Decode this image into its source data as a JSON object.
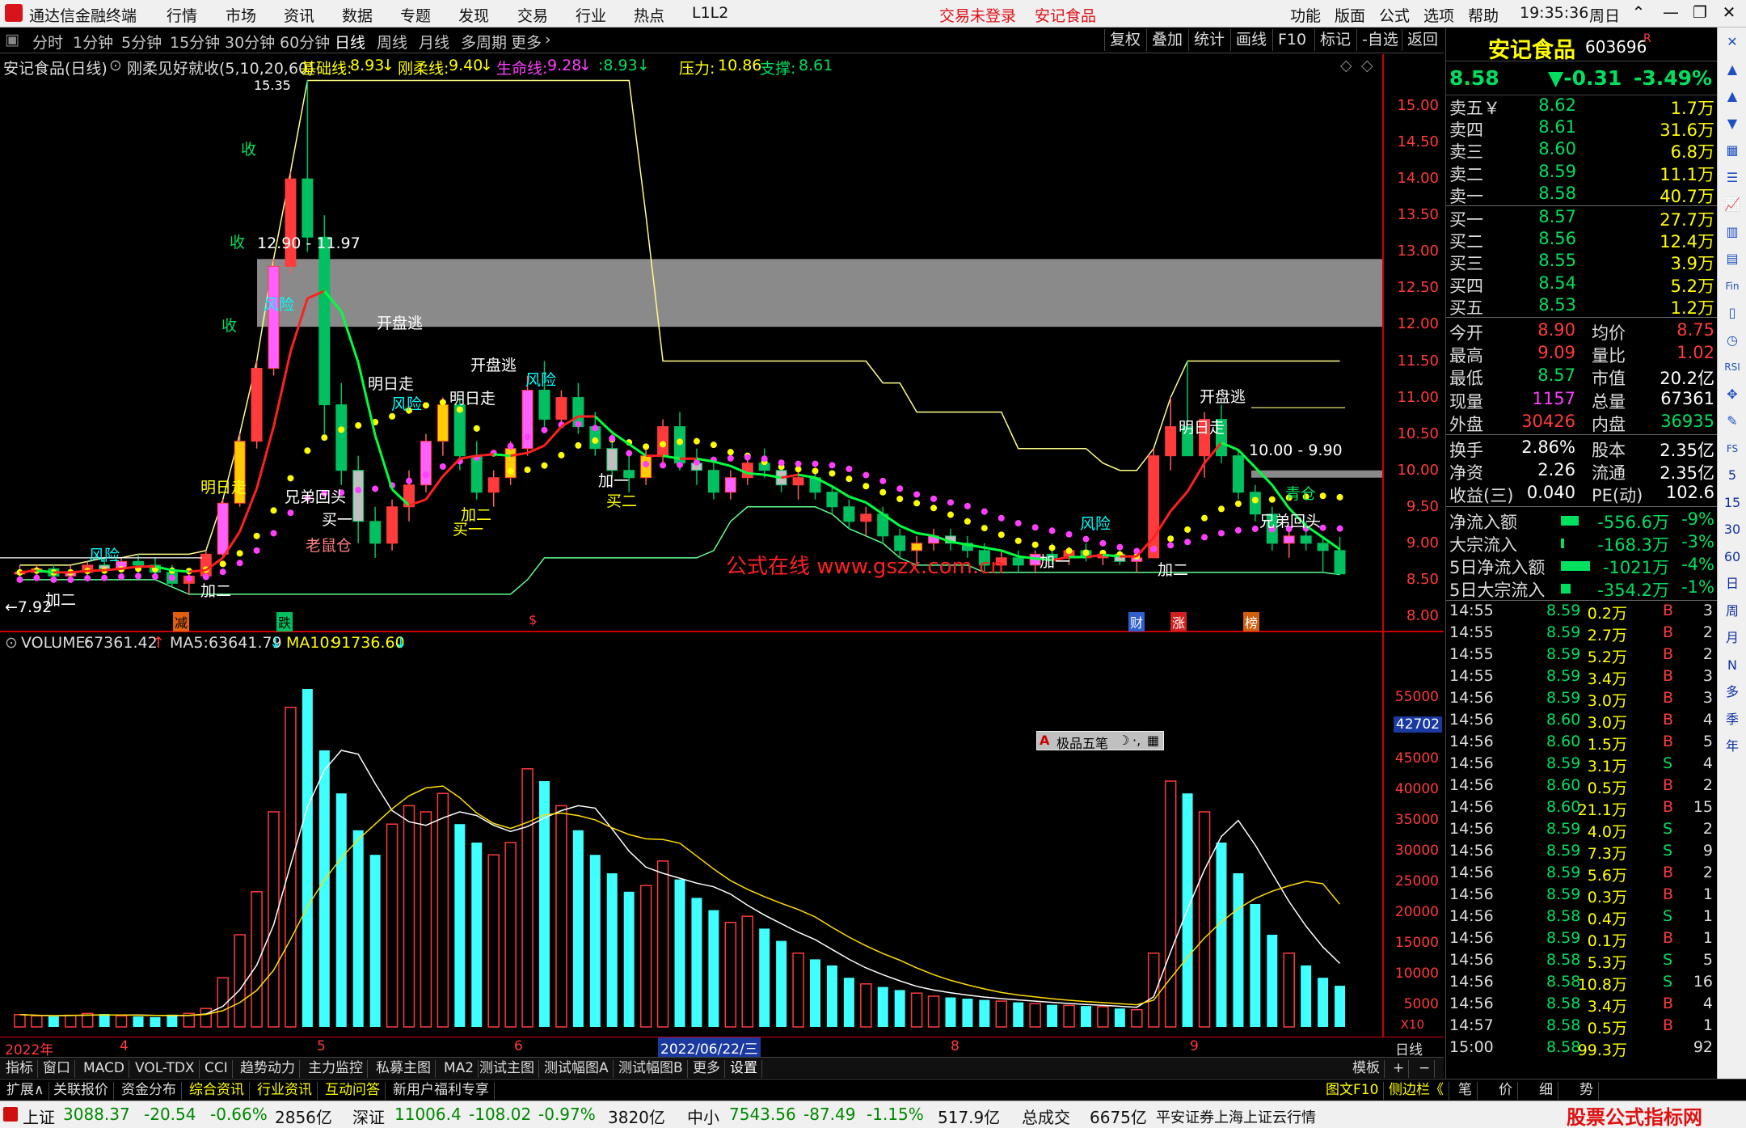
{
  "titlebar": {
    "app_title": "通达信金融终端",
    "menu": [
      "行情",
      "市场",
      "资讯",
      "数据",
      "专题",
      "发现",
      "交易",
      "行业",
      "热点",
      "L1L2"
    ],
    "notice_login": "交易未登录",
    "notice_stock": "安记食品",
    "right_menu": [
      "功能",
      "版面",
      "公式",
      "选项",
      "帮助"
    ],
    "clock": "19:35:36",
    "weekday": "周日"
  },
  "period_bar": {
    "periods": [
      "分时",
      "1分钟",
      "5分钟",
      "15分钟",
      "30分钟",
      "60分钟",
      "日线",
      "周线",
      "月线",
      "多周期",
      "更多"
    ],
    "active": "日线",
    "right_buttons": [
      "复权",
      "叠加",
      "统计",
      "画线",
      "F10",
      "标记",
      "-自选",
      "返回"
    ]
  },
  "indicator_header": {
    "stock": "安记食品(日线)",
    "formula": "刚柔见好就收(5,10,20,60)",
    "jichu_label": "基础线:",
    "jichu_val": "8.93",
    "gangrou_label": "刚柔线:",
    "gangrou_val": "9.40",
    "shengming_label": "生命线:",
    "shengming_val": "9.28",
    "extra_val": ":8.93",
    "yali_label": "压力:",
    "yali_val": "10.86",
    "zhicheng_label": "支撑:",
    "zhicheng_val": "8.61"
  },
  "price_axis": [
    "15.00",
    "14.50",
    "14.00",
    "13.50",
    "13.00",
    "12.50",
    "12.00",
    "11.50",
    "11.00",
    "10.50",
    "10.00",
    "9.50",
    "9.00",
    "8.50",
    "8.00"
  ],
  "volume_header": {
    "volume_label": "VOLUME:",
    "volume_val": "67361.42",
    "ma5_label": "MA5:",
    "ma5_val": "63641.79",
    "ma10_label": "MA10:",
    "ma10_val": "91736.60"
  },
  "volume_axis": [
    "55000",
    "50000",
    "45000",
    "40000",
    "35000",
    "30000",
    "25000",
    "20000",
    "15000",
    "10000",
    "5000"
  ],
  "volume_axis_current": "42702",
  "volume_axis_unit": "X10",
  "date_axis": {
    "labels": [
      "2022年",
      "4",
      "5",
      "6",
      "2022/06/22/三",
      "8",
      "9"
    ],
    "right": "日线"
  },
  "chart_annotations": {
    "range1": "12.90 - 11.97",
    "range2": "10.00 - 9.90",
    "low_label": "←7.92",
    "high_label": "15.35",
    "watermark": "公式在线 www.gszx.com.cn",
    "markers": [
      "减",
      "跌",
      "$",
      "财",
      "涨",
      "榜"
    ],
    "signals": [
      "开盘逃",
      "明日走",
      "风险",
      "收",
      "加二",
      "买一",
      "买二",
      "兄弟回头",
      "老鼠仓",
      "加一",
      "青仓"
    ]
  },
  "popup": {
    "label": "极品五笔"
  },
  "tabs1": [
    "指标",
    "窗口",
    "MACD",
    "VOL-TDX",
    "CCI",
    "趋势动力",
    "主力监控",
    "私募主图",
    "MA2",
    "测试主图",
    "测试幅图A",
    "测试幅图B",
    "更多",
    "设置",
    "模板"
  ],
  "tabs2": [
    "扩展∧",
    "关联报价",
    "资金分布",
    "综合资讯",
    "行业资讯",
    "互动问答",
    "新用户福利专享"
  ],
  "tabs2_right": [
    "图文F10",
    "侧边栏《",
    "笔",
    "价",
    "细",
    "势"
  ],
  "statusbar": {
    "sh_label": "上证",
    "sh_val": "3088.37",
    "sh_chg": "-20.54",
    "sh_pct": "-0.66%",
    "sh_amt": "2856亿",
    "sz_label": "深证",
    "sz_val": "11006.4",
    "sz_chg": "-108.02",
    "sz_pct": "-0.97%",
    "sz_amt": "3820亿",
    "zx_label": "中小",
    "zx_val": "7543.56",
    "zx_chg": "-87.49",
    "zx_pct": "-1.15%",
    "zx_amt": "517.9亿",
    "total_label": "总成交",
    "total_val": "6675亿",
    "server": "平安证券上海上证云行情"
  },
  "quote": {
    "name": "安记食品",
    "code": "603696",
    "flag": "R",
    "price": "8.58",
    "change": "▼-0.31",
    "pct": "-3.49%",
    "sells": [
      {
        "label": "卖五￥",
        "price": "8.62",
        "vol": "1.7万"
      },
      {
        "label": "卖四",
        "price": "8.61",
        "vol": "31.6万"
      },
      {
        "label": "卖三",
        "price": "8.60",
        "vol": "6.8万"
      },
      {
        "label": "卖二",
        "price": "8.59",
        "vol": "11.1万"
      },
      {
        "label": "卖一",
        "price": "8.58",
        "vol": "40.7万"
      }
    ],
    "buys": [
      {
        "label": "买一",
        "price": "8.57",
        "vol": "27.7万"
      },
      {
        "label": "买二",
        "price": "8.56",
        "vol": "12.4万"
      },
      {
        "label": "买三",
        "price": "8.55",
        "vol": "3.9万"
      },
      {
        "label": "买四",
        "price": "8.54",
        "vol": "5.2万"
      },
      {
        "label": "买五",
        "price": "8.53",
        "vol": "1.2万"
      }
    ],
    "stats": [
      {
        "l1": "今开",
        "v1": "8.90",
        "l2": "均价",
        "v2": "8.75"
      },
      {
        "l1": "最高",
        "v1": "9.09",
        "l2": "量比",
        "v2": "1.02"
      },
      {
        "l1": "最低",
        "v1": "8.57",
        "l2": "市值",
        "v2": "20.2亿"
      },
      {
        "l1": "现量",
        "v1": "1157",
        "l2": "总量",
        "v2": "67361"
      },
      {
        "l1": "外盘",
        "v1": "30426",
        "l2": "内盘",
        "v2": "36935"
      }
    ],
    "stats2": [
      {
        "l1": "换手",
        "v1": "2.86%",
        "l2": "股本",
        "v2": "2.35亿"
      },
      {
        "l1": "净资",
        "v1": "2.26",
        "l2": "流通",
        "v2": "2.35亿"
      },
      {
        "l1": "收益(三)",
        "v1": "0.040",
        "l2": "PE(动)",
        "v2": "102.6"
      }
    ],
    "flows": [
      {
        "label": "净流入额",
        "val": "-556.6万",
        "pct": "-9%"
      },
      {
        "label": "大宗流入",
        "val": "-168.3万",
        "pct": "-3%"
      },
      {
        "label": "5日净流入额",
        "val": "-1021万",
        "pct": "-4%"
      },
      {
        "label": "5日大宗流入",
        "val": "-354.2万",
        "pct": "-1%"
      }
    ],
    "ticks": [
      {
        "t": "14:55",
        "p": "8.59",
        "v": "0.2万",
        "d": "B",
        "n": "3"
      },
      {
        "t": "14:55",
        "p": "8.59",
        "v": "2.7万",
        "d": "B",
        "n": "2"
      },
      {
        "t": "14:55",
        "p": "8.59",
        "v": "5.2万",
        "d": "B",
        "n": "2"
      },
      {
        "t": "14:55",
        "p": "8.59",
        "v": "3.4万",
        "d": "B",
        "n": "3"
      },
      {
        "t": "14:56",
        "p": "8.59",
        "v": "3.0万",
        "d": "B",
        "n": "3"
      },
      {
        "t": "14:56",
        "p": "8.60",
        "v": "3.0万",
        "d": "B",
        "n": "4"
      },
      {
        "t": "14:56",
        "p": "8.60",
        "v": "1.5万",
        "d": "B",
        "n": "5"
      },
      {
        "t": "14:56",
        "p": "8.59",
        "v": "3.1万",
        "d": "S",
        "n": "4"
      },
      {
        "t": "14:56",
        "p": "8.60",
        "v": "0.5万",
        "d": "B",
        "n": "2"
      },
      {
        "t": "14:56",
        "p": "8.60",
        "v": "21.1万",
        "d": "B",
        "n": "15"
      },
      {
        "t": "14:56",
        "p": "8.59",
        "v": "4.0万",
        "d": "S",
        "n": "2"
      },
      {
        "t": "14:56",
        "p": "8.59",
        "v": "7.3万",
        "d": "S",
        "n": "9"
      },
      {
        "t": "14:56",
        "p": "8.59",
        "v": "5.6万",
        "d": "B",
        "n": "2"
      },
      {
        "t": "14:56",
        "p": "8.59",
        "v": "0.3万",
        "d": "B",
        "n": "1"
      },
      {
        "t": "14:56",
        "p": "8.58",
        "v": "0.4万",
        "d": "S",
        "n": "1"
      },
      {
        "t": "14:56",
        "p": "8.59",
        "v": "0.1万",
        "d": "B",
        "n": "1"
      },
      {
        "t": "14:56",
        "p": "8.58",
        "v": "5.3万",
        "d": "S",
        "n": "5"
      },
      {
        "t": "14:56",
        "p": "8.58",
        "v": "10.8万",
        "d": "S",
        "n": "16"
      },
      {
        "t": "14:56",
        "p": "8.58",
        "v": "3.4万",
        "d": "B",
        "n": "4"
      },
      {
        "t": "14:57",
        "p": "8.58",
        "v": "0.5万",
        "d": "B",
        "n": "1"
      },
      {
        "t": "15:00",
        "p": "8.58",
        "v": "99.3万",
        "d": "",
        "n": "92"
      }
    ]
  },
  "sidebar_icons": [
    "close-icon",
    "up-icon",
    "up-icon",
    "down-icon",
    "grid-icon",
    "list-icon",
    "chart-icon",
    "bar-icon",
    "table-icon",
    "fin-icon",
    "book-icon",
    "clock-icon",
    "rsi-icon",
    "move-icon",
    "edit-icon",
    "fs-icon",
    "5",
    "15",
    "30",
    "60",
    "日",
    "周",
    "月",
    "N",
    "多",
    "季",
    "年"
  ],
  "colors": {
    "up": "#ff3b3b",
    "down": "#00ffff",
    "bg": "#000000",
    "yellow": "#ffff00",
    "magenta": "#ff40ff"
  },
  "chart_data": {
    "type": "candlestick",
    "ylim": [
      7.8,
      15.4
    ],
    "candles": [
      [
        8.6,
        8.7,
        8.5,
        8.6
      ],
      [
        8.6,
        8.7,
        8.5,
        8.65
      ],
      [
        8.65,
        8.7,
        8.5,
        8.55
      ],
      [
        8.55,
        8.7,
        8.5,
        8.6
      ],
      [
        8.6,
        8.75,
        8.55,
        8.7
      ],
      [
        8.7,
        8.8,
        8.6,
        8.65
      ],
      [
        8.65,
        8.8,
        8.6,
        8.75
      ],
      [
        8.75,
        8.85,
        8.6,
        8.7
      ],
      [
        8.7,
        8.8,
        8.55,
        8.6
      ],
      [
        8.6,
        8.7,
        8.4,
        8.45
      ],
      [
        8.45,
        8.6,
        8.3,
        8.55
      ],
      [
        8.55,
        8.9,
        8.5,
        8.85
      ],
      [
        8.85,
        9.6,
        8.8,
        9.55
      ],
      [
        9.55,
        10.5,
        9.5,
        10.4
      ],
      [
        10.4,
        11.5,
        10.3,
        11.4
      ],
      [
        11.4,
        12.9,
        11.3,
        12.8
      ],
      [
        12.8,
        14.1,
        12.7,
        14.0
      ],
      [
        14.0,
        15.35,
        13.0,
        13.2
      ],
      [
        13.2,
        13.5,
        10.5,
        10.9
      ],
      [
        10.9,
        11.2,
        9.8,
        10.0
      ],
      [
        10.0,
        10.2,
        9.0,
        9.3
      ],
      [
        9.3,
        9.5,
        8.8,
        9.0
      ],
      [
        9.0,
        9.6,
        8.9,
        9.5
      ],
      [
        9.5,
        10.0,
        9.3,
        9.8
      ],
      [
        9.8,
        10.5,
        9.7,
        10.4
      ],
      [
        10.4,
        11.0,
        10.2,
        10.9
      ],
      [
        10.9,
        11.0,
        10.0,
        10.2
      ],
      [
        10.2,
        10.4,
        9.6,
        9.7
      ],
      [
        9.7,
        10.0,
        9.5,
        9.9
      ],
      [
        9.9,
        10.4,
        9.8,
        10.3
      ],
      [
        10.3,
        11.3,
        10.2,
        11.1
      ],
      [
        11.1,
        11.5,
        10.6,
        10.7
      ],
      [
        10.7,
        11.1,
        10.6,
        11.0
      ],
      [
        11.0,
        11.2,
        10.5,
        10.6
      ],
      [
        10.6,
        10.8,
        10.2,
        10.3
      ],
      [
        10.3,
        10.5,
        9.9,
        10.0
      ],
      [
        10.0,
        10.2,
        9.7,
        9.9
      ],
      [
        9.9,
        10.3,
        9.8,
        10.2
      ],
      [
        10.2,
        10.7,
        10.1,
        10.6
      ],
      [
        10.6,
        10.8,
        10.0,
        10.1
      ],
      [
        10.1,
        10.3,
        9.8,
        10.0
      ],
      [
        10.0,
        10.1,
        9.6,
        9.7
      ],
      [
        9.7,
        10.0,
        9.6,
        9.9
      ],
      [
        9.9,
        10.2,
        9.8,
        10.1
      ],
      [
        10.1,
        10.3,
        9.9,
        10.0
      ],
      [
        10.0,
        10.1,
        9.7,
        9.8
      ],
      [
        9.8,
        10.0,
        9.6,
        9.9
      ],
      [
        9.9,
        10.0,
        9.6,
        9.7
      ],
      [
        9.7,
        9.8,
        9.4,
        9.5
      ],
      [
        9.5,
        9.6,
        9.2,
        9.3
      ],
      [
        9.3,
        9.5,
        9.1,
        9.4
      ],
      [
        9.4,
        9.5,
        9.0,
        9.1
      ],
      [
        9.1,
        9.2,
        8.8,
        8.9
      ],
      [
        8.9,
        9.1,
        8.7,
        9.0
      ],
      [
        9.0,
        9.2,
        8.9,
        9.1
      ],
      [
        9.1,
        9.2,
        8.9,
        9.0
      ],
      [
        9.0,
        9.1,
        8.8,
        8.9
      ],
      [
        8.9,
        9.0,
        8.6,
        8.7
      ],
      [
        8.7,
        8.9,
        8.6,
        8.8
      ],
      [
        8.8,
        8.9,
        8.6,
        8.7
      ],
      [
        8.7,
        8.9,
        8.6,
        8.85
      ],
      [
        8.85,
        9.0,
        8.7,
        8.8
      ],
      [
        8.8,
        8.95,
        8.7,
        8.9
      ],
      [
        8.9,
        9.0,
        8.75,
        8.8
      ],
      [
        8.8,
        8.9,
        8.7,
        8.85
      ],
      [
        8.85,
        8.9,
        8.7,
        8.75
      ],
      [
        8.75,
        8.9,
        8.6,
        8.8
      ],
      [
        8.8,
        10.3,
        8.8,
        10.2
      ],
      [
        10.2,
        11.0,
        10.0,
        10.6
      ],
      [
        10.6,
        11.5,
        10.4,
        10.2
      ],
      [
        10.2,
        10.8,
        9.9,
        10.7
      ],
      [
        10.7,
        10.9,
        10.1,
        10.2
      ],
      [
        10.2,
        10.3,
        9.6,
        9.7
      ],
      [
        9.7,
        9.8,
        9.3,
        9.4
      ],
      [
        9.4,
        9.5,
        8.9,
        9.0
      ],
      [
        9.0,
        9.2,
        8.8,
        9.1
      ],
      [
        9.1,
        9.3,
        8.9,
        9.0
      ],
      [
        9.0,
        9.1,
        8.6,
        8.9
      ],
      [
        8.9,
        9.09,
        8.57,
        8.58
      ]
    ],
    "volumes": [
      2000,
      1800,
      1700,
      1900,
      2200,
      2100,
      1800,
      1700,
      1600,
      2000,
      2200,
      3000,
      8000,
      15000,
      22000,
      35000,
      52000,
      55000,
      45000,
      38000,
      32000,
      28000,
      33000,
      36000,
      35000,
      38000,
      33000,
      30000,
      28000,
      30000,
      42000,
      40000,
      36000,
      32000,
      28000,
      25000,
      22000,
      23000,
      27000,
      24000,
      21000,
      19000,
      17000,
      18000,
      16000,
      14000,
      12000,
      11000,
      10000,
      8000,
      7000,
      6500,
      6000,
      5500,
      5000,
      4800,
      4600,
      4400,
      4200,
      4000,
      3800,
      3600,
      3500,
      3400,
      3300,
      3000,
      2800,
      12000,
      40000,
      38000,
      35000,
      30000,
      25000,
      20000,
      15000,
      12000,
      10000,
      8000,
      6700
    ],
    "series": [
      {
        "name": "基础线",
        "color": "#ffff00"
      },
      {
        "name": "生命线",
        "color": "#ff40ff"
      },
      {
        "name": "压力",
        "color": "#ffff88"
      },
      {
        "name": "支撑",
        "color": "#60ff90"
      },
      {
        "name": "MA5",
        "color": "#ffffff"
      },
      {
        "name": "MA10",
        "color": "#ffdd00"
      }
    ]
  }
}
